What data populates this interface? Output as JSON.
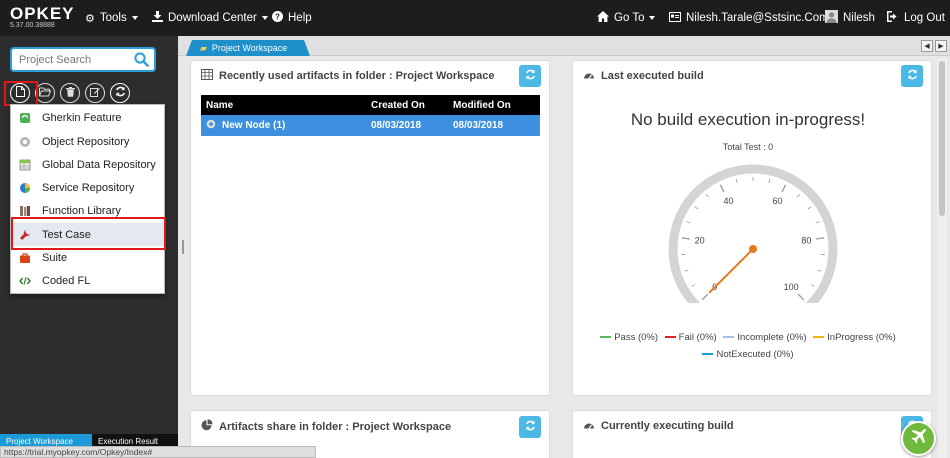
{
  "app": {
    "logo": "OPKEY",
    "version": "5.37.00.38888"
  },
  "nav": {
    "tools": "Tools",
    "download_center": "Download Center",
    "help": "Help",
    "goto": "Go To",
    "email": "Nilesh.Tarale@Sstsinc.Com",
    "user": "Nilesh",
    "logout": "Log Out"
  },
  "sidebar": {
    "search_placeholder": "Project Search",
    "menu": [
      {
        "label": "Gherkin Feature",
        "icon": "gherkin-icon"
      },
      {
        "label": "Object Repository",
        "icon": "object-repository-icon"
      },
      {
        "label": "Global Data Repository",
        "icon": "data-repository-icon"
      },
      {
        "label": "Service Repository",
        "icon": "service-repository-icon"
      },
      {
        "label": "Function Library",
        "icon": "function-library-icon"
      },
      {
        "label": "Test Case",
        "icon": "test-case-icon"
      },
      {
        "label": "Suite",
        "icon": "suite-icon"
      },
      {
        "label": "Coded FL",
        "icon": "coded-fl-icon"
      }
    ],
    "bottom_tabs": [
      "Project Workspace",
      "Execution Result"
    ]
  },
  "status_url": "https://trial.myopkey.com/Opkey/Index#",
  "workspace_tab": "Project Workspace",
  "recent_panel": {
    "title": "Recently used artifacts in folder : Project Workspace",
    "columns": [
      "Name",
      "Created On",
      "Modified On"
    ],
    "rows": [
      {
        "name": "New Node (1)",
        "created": "08/03/2018",
        "modified": "08/03/2018"
      }
    ]
  },
  "last_build_panel": {
    "title": "Last executed build",
    "status": "No build execution in-progress!",
    "total_test": "Total Test : 0",
    "gauge": {
      "min": 0,
      "max": 100,
      "value": 0,
      "tick_labels": [
        "0",
        "20",
        "40",
        "60",
        "80",
        "100"
      ]
    },
    "legend": [
      {
        "label": "Pass (0%)",
        "color": "#5cb85c"
      },
      {
        "label": "Fail (0%)",
        "color": "#e02020"
      },
      {
        "label": "Incomplete (0%)",
        "color": "#9fc0e8"
      },
      {
        "label": "InProgress (0%)",
        "color": "#f0b400"
      },
      {
        "label": "NotExecuted (0%)",
        "color": "#1a9ad6"
      }
    ]
  },
  "share_panel": {
    "title": "Artifacts share in folder : Project Workspace"
  },
  "current_build_panel": {
    "title": "Currently executing build"
  },
  "colors": {
    "accent": "#1d8fc9",
    "highlight": "#e01818",
    "needle": "#e8781e"
  }
}
